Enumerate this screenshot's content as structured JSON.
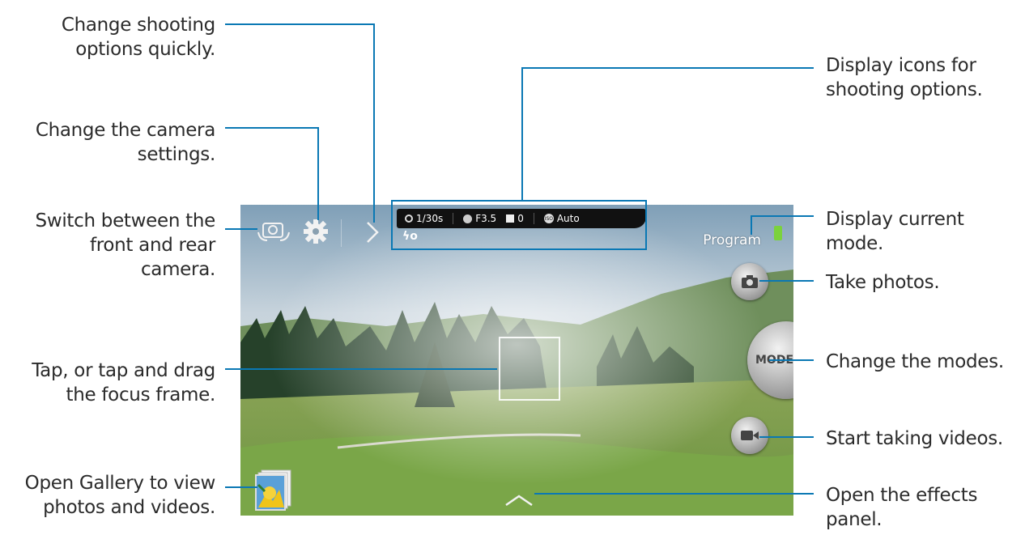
{
  "labels": {
    "change_shooting_options": "Change shooting\noptions quickly.",
    "change_camera_settings": "Change the camera\nsettings.",
    "switch_camera": "Switch between the\nfront and rear\ncamera.",
    "focus_frame": "Tap, or tap and drag\nthe focus frame.",
    "open_gallery": "Open Gallery to view\nphotos and videos.",
    "display_icons": "Display icons for\nshooting options.",
    "display_mode": "Display current\nmode.",
    "take_photos": "Take photos.",
    "change_modes": "Change the modes.",
    "start_videos": "Start taking videos.",
    "open_effects": "Open the effects\npanel."
  },
  "camera": {
    "status": {
      "shutter": "1/30s",
      "aperture": "F3.5",
      "exposure": "0",
      "iso": "Auto",
      "flash": "ϟo"
    },
    "mode_label": "Program",
    "mode_button": "MODE"
  },
  "colors": {
    "leader_line": "#0a78b4",
    "status_bar": "#111111",
    "battery": "#7bd23c"
  }
}
